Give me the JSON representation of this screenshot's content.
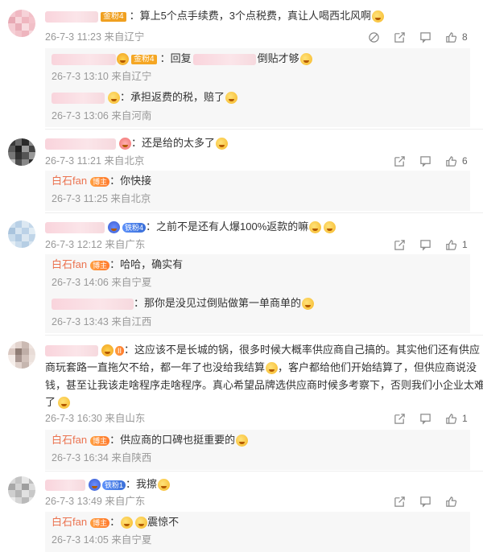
{
  "comments": [
    {
      "text": "：算上5个点手续费，3个点税费，真让人喝西北风啊",
      "badge": "金粉4",
      "meta": "26-7-3 11:23 来自辽宁",
      "likes": "8",
      "replies": [
        {
          "prefix": "：回复",
          "text": "倒贴才够",
          "badge": "金粉4",
          "meta": "26-7-3 13:10 来自辽宁"
        },
        {
          "text": "：承担返费的税，赔了",
          "meta": "26-7-3 13:06 来自河南"
        }
      ]
    },
    {
      "text": "：还是给的太多了",
      "meta": "26-7-3 11:21 来自北京",
      "likes": "6",
      "replies": [
        {
          "author": "白石fan",
          "author_badge": "博主",
          "text": "：你快接",
          "meta": "26-7-3 11:25 来自北京"
        }
      ]
    },
    {
      "text": "：之前不是还有人爆100%返款的嘛",
      "badge": "铁粉4",
      "meta": "26-7-3 12:12 来自广东",
      "likes": "1",
      "replies": [
        {
          "author": "白石fan",
          "author_badge": "博主",
          "text": "：哈哈，确实有",
          "meta": "26-7-3 14:06 来自宁夏"
        },
        {
          "text": "：那你是没见过倒贴做第一单商单的",
          "meta": "26-7-3 13:43 来自江西"
        }
      ]
    },
    {
      "text_line1": "：这应该不是长城的锅，很多时候大概率供应商自己搞的。其实他们还有供应",
      "text_line2": "商玩套路一直拖欠不给，都一年了也没给我结算",
      "text_line2b": "，客户都给他们开始结算了，但供应商说没",
      "text_line3": "钱，甚至让我该走啥程序走啥程序。真心希望品牌选供应商时候多考察下，否则我们小企业太难",
      "text_line4": "了",
      "badge": "II",
      "meta": "26-7-3 16:30 来自山东",
      "likes": "1",
      "replies": [
        {
          "author": "白石fan",
          "author_badge": "博主",
          "text": "：供应商的口碑也挺重要的",
          "meta": "26-7-3 16:34 来自陕西"
        }
      ]
    },
    {
      "text": "：我擦",
      "badge": "铁粉1",
      "meta": "26-7-3 13:49 来自广东",
      "likes": "",
      "replies": [
        {
          "author": "白石fan",
          "author_badge": "博主",
          "text": "：",
          "text_after": "震惊不",
          "meta": "26-7-3 14:05 来自宁夏"
        }
      ]
    }
  ],
  "icons": {
    "block": "block-icon",
    "share": "share-icon",
    "comment": "comment-icon",
    "like": "like-icon"
  }
}
